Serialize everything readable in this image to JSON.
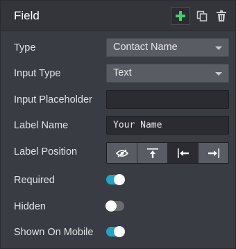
{
  "header": {
    "title": "Field",
    "add_icon": "plus-icon",
    "copy_icon": "copy-icon",
    "trash_icon": "trash-icon",
    "accent": "#3ecf6e"
  },
  "fields": {
    "type": {
      "label": "Type",
      "value": "Contact Name"
    },
    "input_type": {
      "label": "Input Type",
      "value": "Text"
    },
    "input_placeholder": {
      "label": "Input Placeholder",
      "value": ""
    },
    "label_name": {
      "label": "Label Name",
      "value": "Your Name"
    },
    "label_position": {
      "label": "Label Position",
      "options": [
        "hidden-eye-icon",
        "top-arrow-icon",
        "left-arrow-icon",
        "right-arrow-icon"
      ],
      "selected_index": 2
    },
    "required": {
      "label": "Required",
      "checked": true
    },
    "hidden": {
      "label": "Hidden",
      "checked": false
    },
    "shown_on_mobile": {
      "label": "Shown On Mobile",
      "checked": true
    }
  },
  "colors": {
    "toggle_on": "#1fa6c4",
    "toggle_off": "#6a6c72",
    "panel": "#3a3c43"
  }
}
